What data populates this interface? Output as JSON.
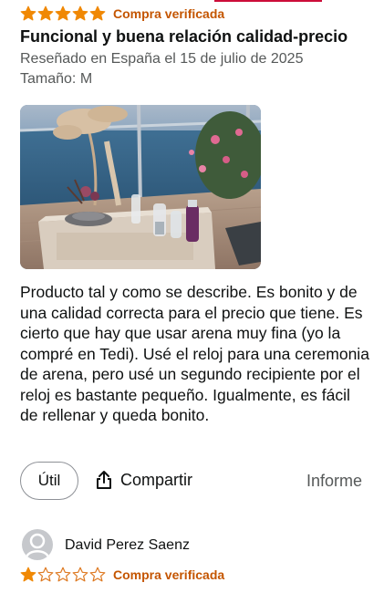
{
  "review": {
    "rating": 5,
    "rating_max": 5,
    "verified": "Compra verificada",
    "title": "Funcional y buena relación calidad-precio",
    "reviewed_in": "Reseñado en España el 15 de julio de 2025",
    "size": "Tamaño: M",
    "body": "Producto tal y como se describe. Es bonito y de una calidad correcta para el precio que tiene. Es cierto que hay que usar arena muy fina (yo la compré en Tedi). Usé el reloj para una ceremonia de arena, pero usé un segundo recipiente por el reloj es bastante pequeño. Igualmente, es fácil de rellenar y queda bonito."
  },
  "actions": {
    "helpful": "Útil",
    "share": "Compartir",
    "report": "Informe"
  },
  "next_review": {
    "author": "David Perez Saenz",
    "rating": 1,
    "rating_max": 5,
    "verified": "Compra verificada"
  },
  "colors": {
    "star": "#f08804",
    "star_empty_stroke": "#de7921",
    "verified": "#c45500",
    "topline": "#cc0c39"
  }
}
